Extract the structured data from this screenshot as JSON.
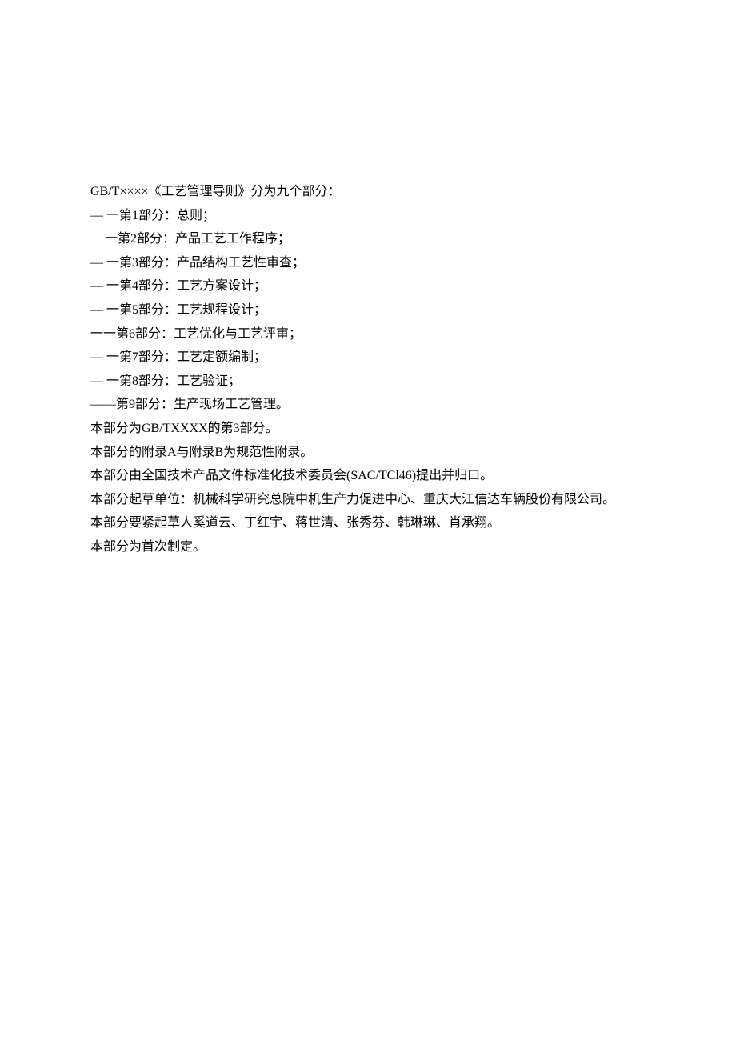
{
  "lines": [
    {
      "text": "GB/T××××《工艺管理导则》分为九个部分：",
      "indent": 0
    },
    {
      "text": "— 一第1部分：总则；",
      "indent": 0
    },
    {
      "text": "一第2部分：产品工艺工作程序；",
      "indent": 2
    },
    {
      "text": "— 一第3部分：产品结构工艺性审查；",
      "indent": 0
    },
    {
      "text": "—  一第4部分：工艺方案设计；",
      "indent": 0
    },
    {
      "text": "— 一第5部分：工艺规程设计；",
      "indent": 0
    },
    {
      "text": "一一第6部分：工艺优化与工艺评审；",
      "indent": 0
    },
    {
      "text": "—  一第7部分：工艺定额编制；",
      "indent": 0
    },
    {
      "text": "—  一第8部分：工艺验证；",
      "indent": 0
    },
    {
      "text": "——第9部分：生产现场工艺管理。",
      "indent": 0
    },
    {
      "text": "本部分为GB/TXXXX的第3部分。",
      "indent": 0
    },
    {
      "text": "本部分的附录A与附录B为规范性附录。",
      "indent": 0
    },
    {
      "text": "本部分由全国技术产品文件标准化技术委员会(SAC/TCl46)提出并归口。",
      "indent": 0
    },
    {
      "text": "本部分起草单位：机械科学研究总院中机生产力促进中心、重庆大江信达车辆股份有限公司。",
      "indent": 0
    },
    {
      "text": "本部分要紧起草人奚道云、丁红宇、蒋世清、张秀芬、韩琳琳、肖承翔。",
      "indent": 0
    },
    {
      "text": "本部分为首次制定。",
      "indent": 0
    }
  ]
}
